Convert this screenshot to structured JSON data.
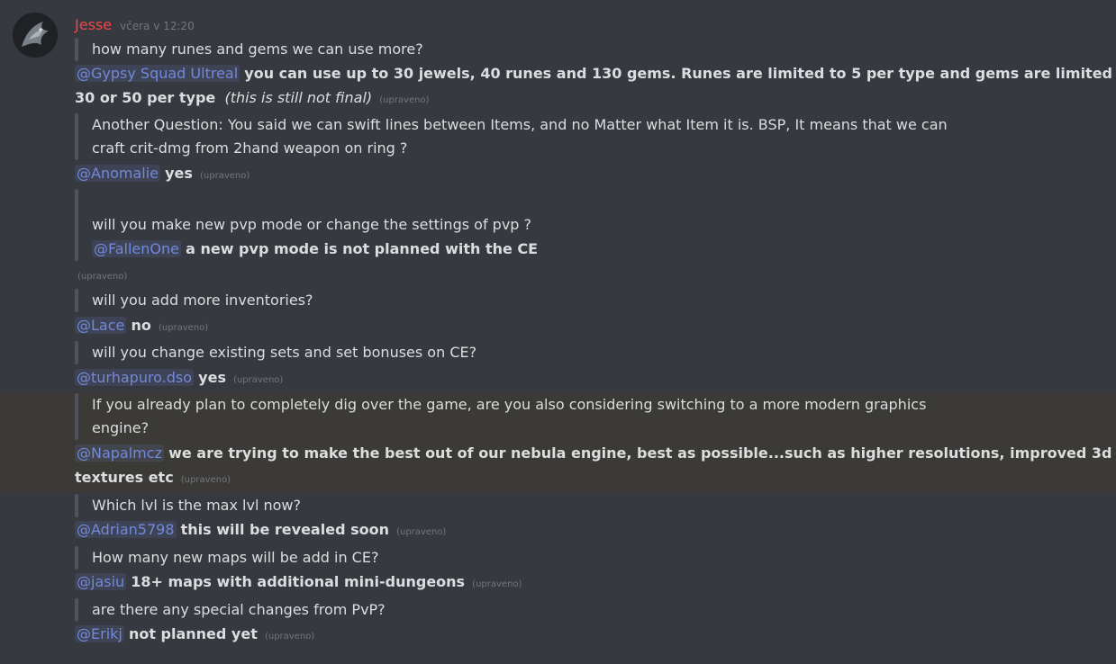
{
  "author": {
    "name": "Jesse",
    "timestamp": "včera v 12:20"
  },
  "edited_label": "(upraveno)",
  "messages": {
    "m1": {
      "question": "how many runes and gems we can use more?",
      "mention": "@Gypsy Squad Ultreal",
      "answer_part1": "you can use up to 30 jewels, 40 runes and 130 gems. Runes are limited to 5 per type and gems are limited to",
      "answer_part2": "30 or 50 per type",
      "italic": "(this is still not final)"
    },
    "m2": {
      "question_line1": "Another Question: You said we can swift lines between Items, and no Matter what Item it is. BSP, It means that we can",
      "question_line2": "craft crit-dmg from 2hand weapon on ring ?",
      "mention": "@Anomalie",
      "answer": "yes"
    },
    "m3": {
      "question": "will you make new pvp mode or change the settings of pvp ?",
      "mention": "@FallenOne",
      "answer": "a new pvp mode is not planned with the CE"
    },
    "m4": {
      "question": "will you add more inventories?",
      "mention": "@Lace",
      "answer": "no"
    },
    "m5": {
      "question": "will you change existing sets and set bonuses on CE?",
      "mention": "@turhapuro.dso",
      "answer": "yes"
    },
    "m6": {
      "question_line1": "If you already plan to completely dig over the game, are you also considering switching to a more modern graphics",
      "question_line2": "engine?",
      "mention": "@Napalmcz",
      "answer_part1": "we are trying to make the best out of our nebula engine, best as possible...such as higher resolutions, improved 3d",
      "answer_part2": "textures etc"
    },
    "m7": {
      "question": "Which lvl is the max lvl now?",
      "mention": "@Adrian5798",
      "answer": "this will be revealed soon"
    },
    "m8": {
      "question": "How many new maps will be add in CE?",
      "mention": "@jasiu",
      "answer": "18+ maps with additional mini-dungeons"
    },
    "m9": {
      "question": "are there any special changes from PvP?",
      "mention": "@Erikj",
      "answer": "not planned yet"
    }
  }
}
